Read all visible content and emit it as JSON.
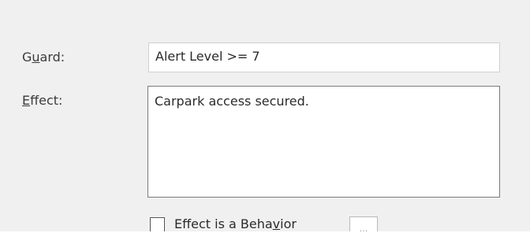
{
  "guard": {
    "label_prefix": "G",
    "label_mnemonic": "u",
    "label_suffix": "ard:",
    "value": "Alert Level >= 7"
  },
  "effect": {
    "label_prefix": "",
    "label_mnemonic": "E",
    "label_suffix": "ffect:",
    "value": "Carpark access secured."
  },
  "behavior_checkbox": {
    "checked": false,
    "label_prefix": "Effect is a Beha",
    "label_mnemonic": "v",
    "label_suffix": "ior"
  },
  "browse_button": {
    "label": "..."
  }
}
